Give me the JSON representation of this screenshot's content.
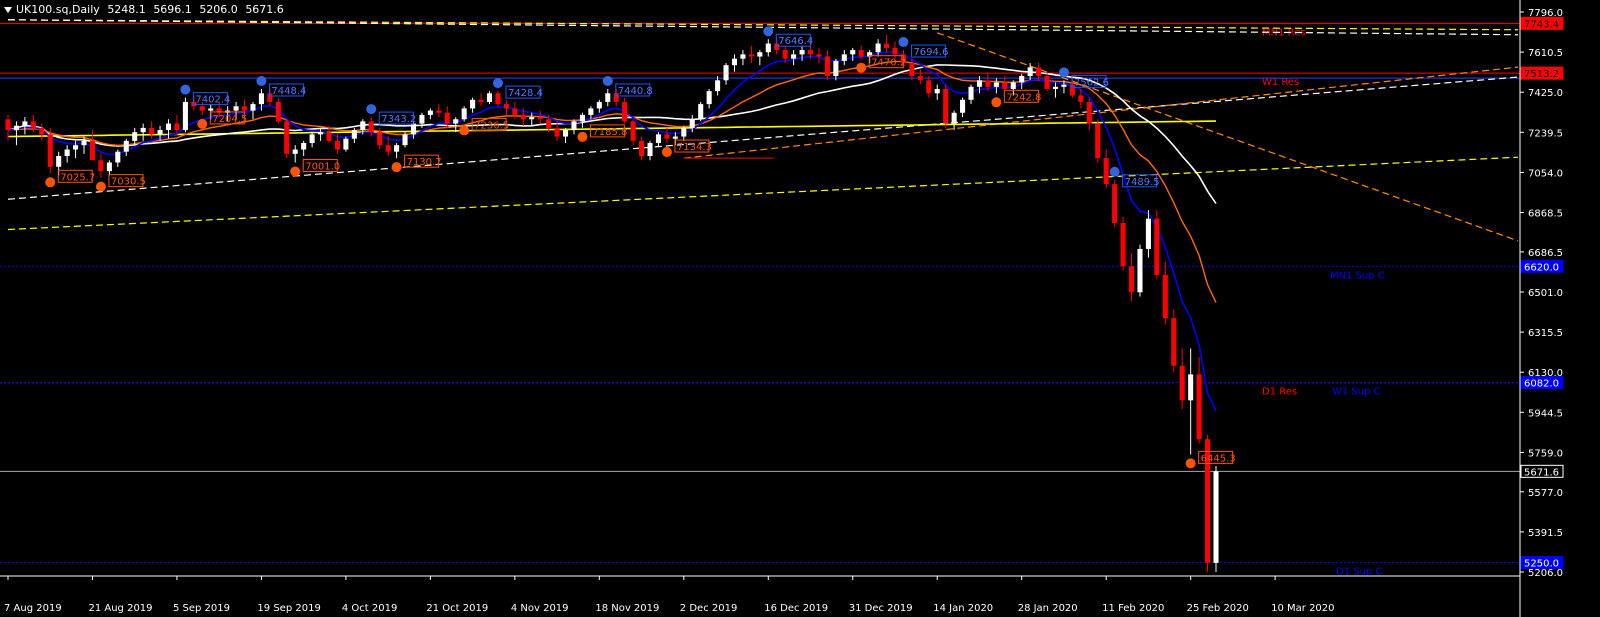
{
  "header": {
    "symbol": "UK100.sq,Daily",
    "open": "5248.1",
    "high": "5696.1",
    "low": "5206.0",
    "close": "5671.6"
  },
  "chart_data": {
    "type": "candlestick",
    "symbol": "UK100.sq",
    "timeframe": "Daily",
    "ylim": [
      5206.0,
      7796.0
    ],
    "y_ticks": [
      "7796.0",
      "7610.5",
      "7425.0",
      "7239.5",
      "7054.0",
      "6868.5",
      "6686.5",
      "6501.0",
      "6315.5",
      "6130.0",
      "5944.5",
      "5759.0",
      "5577.0",
      "5391.5",
      "5206.0"
    ],
    "x_ticks": [
      "7 Aug 2019",
      "21 Aug 2019",
      "5 Sep 2019",
      "19 Sep 2019",
      "4 Oct 2019",
      "21 Oct 2019",
      "4 Nov 2019",
      "18 Nov 2019",
      "2 Dec 2019",
      "16 Dec 2019",
      "31 Dec 2019",
      "14 Jan 2020",
      "28 Jan 2020",
      "11 Feb 2020",
      "25 Feb 2020",
      "10 Mar 2020"
    ],
    "x_tick_index": [
      0,
      10,
      20,
      30,
      40,
      50,
      60,
      70,
      80,
      90,
      100,
      110,
      120,
      130,
      140,
      150
    ],
    "candles": [
      [
        7300,
        7320,
        7200,
        7250
      ],
      [
        7250,
        7290,
        7180,
        7270
      ],
      [
        7270,
        7310,
        7230,
        7290
      ],
      [
        7290,
        7320,
        7240,
        7260
      ],
      [
        7260,
        7280,
        7200,
        7230
      ],
      [
        7230,
        7260,
        7050,
        7080
      ],
      [
        7080,
        7150,
        7040,
        7130
      ],
      [
        7130,
        7180,
        7100,
        7160
      ],
      [
        7160,
        7200,
        7120,
        7180
      ],
      [
        7180,
        7220,
        7140,
        7200
      ],
      [
        7200,
        7250,
        7150,
        7110
      ],
      [
        7110,
        7140,
        7030,
        7060
      ],
      [
        7060,
        7110,
        7040,
        7100
      ],
      [
        7100,
        7160,
        7080,
        7150
      ],
      [
        7150,
        7210,
        7130,
        7200
      ],
      [
        7200,
        7260,
        7180,
        7240
      ],
      [
        7240,
        7280,
        7200,
        7260
      ],
      [
        7260,
        7290,
        7210,
        7230
      ],
      [
        7230,
        7270,
        7200,
        7250
      ],
      [
        7250,
        7300,
        7210,
        7280
      ],
      [
        7280,
        7320,
        7230,
        7250
      ],
      [
        7250,
        7400,
        7240,
        7380
      ],
      [
        7380,
        7410,
        7340,
        7360
      ],
      [
        7360,
        7380,
        7320,
        7340
      ],
      [
        7340,
        7370,
        7300,
        7350
      ],
      [
        7350,
        7380,
        7310,
        7330
      ],
      [
        7330,
        7360,
        7290,
        7340
      ],
      [
        7340,
        7380,
        7300,
        7360
      ],
      [
        7360,
        7390,
        7320,
        7340
      ],
      [
        7340,
        7380,
        7300,
        7370
      ],
      [
        7370,
        7440,
        7340,
        7420
      ],
      [
        7420,
        7440,
        7360,
        7380
      ],
      [
        7380,
        7400,
        7280,
        7290
      ],
      [
        7290,
        7300,
        7120,
        7140
      ],
      [
        7140,
        7180,
        7100,
        7160
      ],
      [
        7160,
        7200,
        7130,
        7190
      ],
      [
        7190,
        7240,
        7170,
        7230
      ],
      [
        7230,
        7260,
        7200,
        7240
      ],
      [
        7240,
        7270,
        7190,
        7200
      ],
      [
        7200,
        7230,
        7140,
        7160
      ],
      [
        7160,
        7220,
        7150,
        7210
      ],
      [
        7210,
        7260,
        7190,
        7250
      ],
      [
        7250,
        7300,
        7230,
        7290
      ],
      [
        7290,
        7310,
        7220,
        7240
      ],
      [
        7240,
        7260,
        7160,
        7180
      ],
      [
        7180,
        7220,
        7130,
        7150
      ],
      [
        7150,
        7190,
        7120,
        7180
      ],
      [
        7180,
        7240,
        7170,
        7230
      ],
      [
        7230,
        7290,
        7210,
        7280
      ],
      [
        7280,
        7330,
        7260,
        7320
      ],
      [
        7320,
        7350,
        7300,
        7340
      ],
      [
        7340,
        7370,
        7310,
        7330
      ],
      [
        7330,
        7360,
        7260,
        7280
      ],
      [
        7280,
        7310,
        7240,
        7300
      ],
      [
        7300,
        7360,
        7290,
        7350
      ],
      [
        7350,
        7400,
        7330,
        7390
      ],
      [
        7390,
        7420,
        7360,
        7380
      ],
      [
        7380,
        7430,
        7370,
        7420
      ],
      [
        7420,
        7430,
        7360,
        7370
      ],
      [
        7370,
        7390,
        7320,
        7350
      ],
      [
        7350,
        7380,
        7300,
        7320
      ],
      [
        7320,
        7350,
        7270,
        7300
      ],
      [
        7300,
        7330,
        7270,
        7310
      ],
      [
        7310,
        7340,
        7280,
        7300
      ],
      [
        7300,
        7320,
        7240,
        7260
      ],
      [
        7260,
        7290,
        7200,
        7220
      ],
      [
        7220,
        7260,
        7190,
        7250
      ],
      [
        7250,
        7300,
        7230,
        7290
      ],
      [
        7290,
        7330,
        7260,
        7320
      ],
      [
        7320,
        7360,
        7300,
        7350
      ],
      [
        7350,
        7390,
        7330,
        7380
      ],
      [
        7380,
        7440,
        7360,
        7420
      ],
      [
        7420,
        7440,
        7360,
        7380
      ],
      [
        7380,
        7400,
        7280,
        7290
      ],
      [
        7290,
        7300,
        7180,
        7200
      ],
      [
        7200,
        7220,
        7110,
        7130
      ],
      [
        7130,
        7200,
        7110,
        7190
      ],
      [
        7190,
        7240,
        7170,
        7230
      ],
      [
        7230,
        7260,
        7190,
        7210
      ],
      [
        7210,
        7240,
        7180,
        7220
      ],
      [
        7220,
        7270,
        7200,
        7260
      ],
      [
        7260,
        7320,
        7240,
        7300
      ],
      [
        7300,
        7380,
        7290,
        7370
      ],
      [
        7370,
        7440,
        7350,
        7430
      ],
      [
        7430,
        7500,
        7410,
        7480
      ],
      [
        7480,
        7560,
        7460,
        7550
      ],
      [
        7550,
        7600,
        7520,
        7580
      ],
      [
        7580,
        7620,
        7550,
        7600
      ],
      [
        7600,
        7640,
        7560,
        7590
      ],
      [
        7590,
        7620,
        7550,
        7610
      ],
      [
        7610,
        7670,
        7590,
        7650
      ],
      [
        7650,
        7680,
        7600,
        7620
      ],
      [
        7620,
        7640,
        7560,
        7580
      ],
      [
        7580,
        7620,
        7550,
        7600
      ],
      [
        7600,
        7640,
        7570,
        7620
      ],
      [
        7620,
        7650,
        7580,
        7600
      ],
      [
        7600,
        7630,
        7560,
        7590
      ],
      [
        7590,
        7620,
        7480,
        7500
      ],
      [
        7500,
        7580,
        7480,
        7570
      ],
      [
        7570,
        7620,
        7550,
        7600
      ],
      [
        7600,
        7630,
        7570,
        7620
      ],
      [
        7620,
        7640,
        7580,
        7590
      ],
      [
        7590,
        7620,
        7560,
        7610
      ],
      [
        7610,
        7670,
        7590,
        7650
      ],
      [
        7650,
        7690,
        7610,
        7630
      ],
      [
        7630,
        7660,
        7580,
        7600
      ],
      [
        7600,
        7620,
        7540,
        7560
      ],
      [
        7560,
        7580,
        7480,
        7500
      ],
      [
        7500,
        7530,
        7460,
        7480
      ],
      [
        7480,
        7500,
        7400,
        7420
      ],
      [
        7420,
        7460,
        7390,
        7440
      ],
      [
        7440,
        7460,
        7260,
        7280
      ],
      [
        7280,
        7340,
        7250,
        7330
      ],
      [
        7330,
        7400,
        7310,
        7390
      ],
      [
        7390,
        7460,
        7370,
        7450
      ],
      [
        7450,
        7500,
        7420,
        7480
      ],
      [
        7480,
        7510,
        7430,
        7450
      ],
      [
        7450,
        7490,
        7420,
        7470
      ],
      [
        7470,
        7500,
        7430,
        7440
      ],
      [
        7440,
        7480,
        7410,
        7470
      ],
      [
        7470,
        7510,
        7440,
        7500
      ],
      [
        7500,
        7560,
        7480,
        7540
      ],
      [
        7540,
        7560,
        7480,
        7500
      ],
      [
        7500,
        7520,
        7430,
        7440
      ],
      [
        7440,
        7470,
        7400,
        7450
      ],
      [
        7450,
        7480,
        7420,
        7460
      ],
      [
        7460,
        7490,
        7400,
        7410
      ],
      [
        7410,
        7440,
        7350,
        7380
      ],
      [
        7380,
        7400,
        7250,
        7280
      ],
      [
        7280,
        7300,
        7100,
        7120
      ],
      [
        7120,
        7160,
        6980,
        7000
      ],
      [
        7000,
        7020,
        6800,
        6820
      ],
      [
        6820,
        6850,
        6600,
        6620
      ],
      [
        6620,
        6680,
        6460,
        6500
      ],
      [
        6500,
        6720,
        6480,
        6700
      ],
      [
        6700,
        6880,
        6660,
        6840
      ],
      [
        6840,
        6880,
        6560,
        6580
      ],
      [
        6580,
        6640,
        6350,
        6380
      ],
      [
        6380,
        6420,
        6130,
        6160
      ],
      [
        6160,
        6240,
        5960,
        6000
      ],
      [
        6000,
        6240,
        5750,
        6120
      ],
      [
        6120,
        6200,
        5800,
        5820
      ],
      [
        5820,
        5840,
        5206,
        5248
      ],
      [
        5248,
        5696,
        5206,
        5671.6
      ]
    ],
    "ma_fast_color": "#0000ff",
    "ma_slow_color": "#ff6a00",
    "ma_long_color": "#ffffff",
    "ma_200_color": "#ffff00",
    "bull_color": "#ffffff",
    "bear_color": "#ff0000",
    "swing_highs": [
      {
        "i": 21,
        "label": "7402.4"
      },
      {
        "i": 30,
        "label": "7448.4"
      },
      {
        "i": 43,
        "label": "7343.2"
      },
      {
        "i": 58,
        "label": "7428.4"
      },
      {
        "i": 71,
        "label": "7440.8"
      },
      {
        "i": 90,
        "label": "7646.4"
      },
      {
        "i": 106,
        "label": "7694.6"
      },
      {
        "i": 125,
        "label": "7562.6"
      },
      {
        "i": 131,
        "label": "7489.5"
      }
    ],
    "swing_lows": [
      {
        "i": 5,
        "label": "7025.7"
      },
      {
        "i": 11,
        "label": "7030.5"
      },
      {
        "i": 23,
        "label": "7204.5"
      },
      {
        "i": 34,
        "label": "7001.0"
      },
      {
        "i": 46,
        "label": "7130.7"
      },
      {
        "i": 54,
        "label": "7236.5"
      },
      {
        "i": 68,
        "label": "7185.8"
      },
      {
        "i": 78,
        "label": "7134.3"
      },
      {
        "i": 101,
        "label": "7470.2"
      },
      {
        "i": 117,
        "label": "7242.8"
      },
      {
        "i": 140,
        "label": "6445.3"
      }
    ],
    "levels": [
      {
        "value": 7743.4,
        "name": "MN1 Res",
        "color": "#ff0000",
        "style": "solid",
        "label_color": "#ff0000",
        "tag": "7743.4",
        "tag_color": "#ff0000",
        "tag_text_color": "#000000"
      },
      {
        "value": 7513.2,
        "name": "W1 Res",
        "color": "#ff0000",
        "style": "solid",
        "label_color": "#ff0000",
        "tag": "7513.2",
        "tag_color": "#ff0000",
        "tag_text_color": "#000000"
      },
      {
        "value": 7490.0,
        "name": "",
        "color": "#2244ff",
        "style": "solid",
        "label_color": "#2244ff",
        "tag": "",
        "tag_color": "",
        "tag_text_color": ""
      },
      {
        "value": 6620.0,
        "name": "MN1 Sup C",
        "color": "#0000ff",
        "style": "dot",
        "label_color": "#0000ff",
        "tag": "6620.0",
        "tag_color": "#0000ff",
        "tag_text_color": "#ffffff"
      },
      {
        "value": 6082.0,
        "name": "D1 Res",
        "color": "#ff0000",
        "style": "dot",
        "label_color": "#ff0000",
        "tag": "",
        "tag_color": "",
        "tag_text_color": ""
      },
      {
        "value": 6082.0,
        "name": "W1 Sup C",
        "color": "#0000ff",
        "style": "dot",
        "label_color": "#0000ff",
        "tag": "6082.0",
        "tag_color": "#0000ff",
        "tag_text_color": "#ffffff"
      },
      {
        "value": 5671.6,
        "name": "",
        "color": "#aaaaaa",
        "style": "solid",
        "label_color": "#ffffff",
        "tag": "5671.6",
        "tag_color": "#000000",
        "tag_text_color": "#ffffff"
      },
      {
        "value": 5250.0,
        "name": "D1 Sup C",
        "color": "#0000ff",
        "style": "dot",
        "label_color": "#0000ff",
        "tag": "5250.0",
        "tag_color": "#0000ff",
        "tag_text_color": "#ffffff"
      }
    ],
    "trendlines": [
      {
        "from": [
          0,
          7760
        ],
        "to": [
          155,
          7720
        ],
        "color": "#ffff00"
      },
      {
        "from": [
          0,
          7760
        ],
        "to": [
          155,
          7700
        ],
        "color": "#ffffff"
      },
      {
        "from": [
          0,
          6930
        ],
        "to": [
          155,
          7420
        ],
        "color": "#ffffff"
      },
      {
        "from": [
          0,
          6790
        ],
        "to": [
          155,
          7080
        ],
        "color": "#ffff00"
      },
      {
        "from": [
          80,
          7120
        ],
        "to": [
          155,
          7440
        ],
        "color": "#ff8c00"
      },
      {
        "from": [
          110,
          7700
        ],
        "to": [
          155,
          7070
        ],
        "color": "#ff8c00"
      }
    ],
    "cursor_line": {
      "from": [
        80,
        7120
      ],
      "to": [
        90,
        7120
      ],
      "color": "#ff0000"
    }
  }
}
